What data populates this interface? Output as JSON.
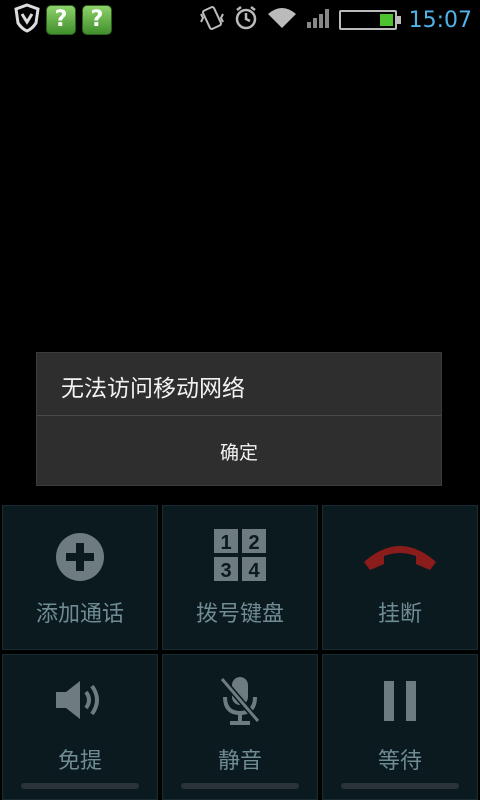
{
  "status_bar": {
    "time": "15:07",
    "icons_left": [
      "shield-icon",
      "question-app-icon",
      "question-app-icon"
    ],
    "icons_right": [
      "vibrate-icon",
      "alarm-icon",
      "wifi-icon",
      "signal-icon",
      "battery-icon"
    ],
    "q1": "?",
    "q2": "?",
    "battery_level": 0.25,
    "accent_color": "#4fb3e8"
  },
  "dialog": {
    "message": "无法访问移动网络",
    "confirm_label": "确定"
  },
  "controls": {
    "add_call": "添加通话",
    "dialpad": "拨号键盘",
    "hangup": "挂断",
    "speaker": "免提",
    "mute": "静音",
    "hold": "等待",
    "dialpad_digits": [
      "1",
      "2",
      "3",
      "4"
    ]
  }
}
